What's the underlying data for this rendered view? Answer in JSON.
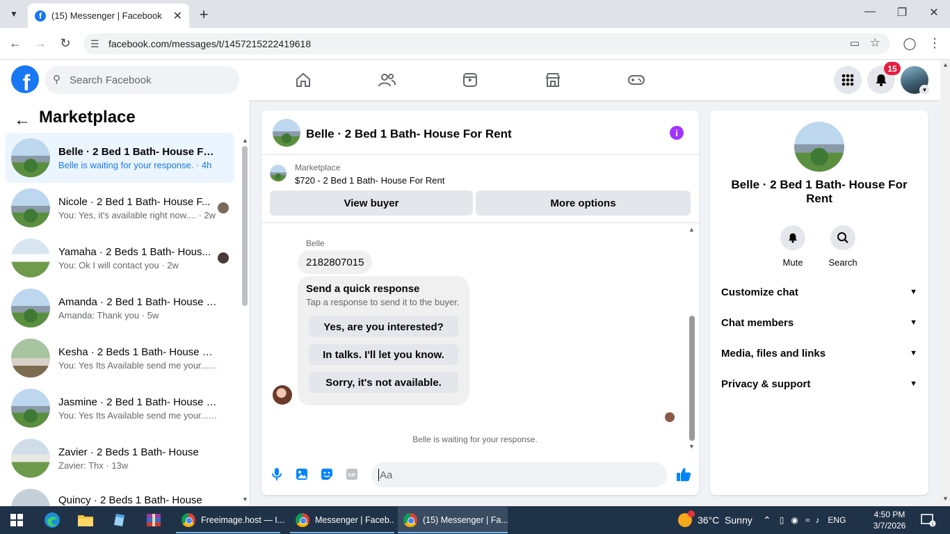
{
  "browser": {
    "tab_title": "(15) Messenger | Facebook",
    "url": "facebook.com/messages/t/1457215222419618"
  },
  "fb": {
    "search_placeholder": "Search Facebook",
    "notification_count": "15"
  },
  "left": {
    "title": "Marketplace",
    "conversations": [
      {
        "name": "Belle · 2 Bed 1 Bath- House For ...",
        "preview": "Belle is waiting for your response. · 4h"
      },
      {
        "name": "Nicole · 2 Bed 1 Bath- House F...",
        "preview": "You: Yes, it's available right now.... · 2w"
      },
      {
        "name": "Yamaha · 2 Beds 1 Bath- Hous...",
        "preview": "You: Ok I will contact you · 2w"
      },
      {
        "name": "Amanda · 2 Bed 1 Bath- House F...",
        "preview": "Amanda: Thank you · 5w"
      },
      {
        "name": "Kesha · 2 Beds 1 Bath- House Fo...",
        "preview": "You: Yes Its Available send me your... · 6w"
      },
      {
        "name": "Jasmine · 2 Bed 1 Bath- House F...",
        "preview": "You: Yes Its Available send me your... · 6w"
      },
      {
        "name": "Zavier · 2 Beds 1 Bath- House",
        "preview": "Zavier: Thx · 13w"
      },
      {
        "name": "Quincy · 2 Beds 1 Bath- House",
        "preview": ""
      }
    ]
  },
  "chat": {
    "title": "Belle · 2 Bed 1 Bath- House For Rent",
    "marketplace_label": "Marketplace",
    "listing": "$720 - 2 Bed 1 Bath- House For Rent",
    "view_buyer": "View buyer",
    "more_options": "More options",
    "sender": "Belle",
    "message": "2182807015",
    "quick_title": "Send a quick response",
    "quick_sub": "Tap a response to send it to the buyer.",
    "quick_options": [
      "Yes, are you interested?",
      "In talks. I'll let you know.",
      "Sorry, it's not available."
    ],
    "waiting": "Belle is waiting for your response.",
    "input_placeholder": "Aa"
  },
  "right": {
    "name": "Belle · 2 Bed 1 Bath- House For Rent",
    "mute": "Mute",
    "search": "Search",
    "rows": [
      "Customize chat",
      "Chat members",
      "Media, files and links",
      "Privacy & support"
    ]
  },
  "taskbar": {
    "apps": [
      "Freeimage.host — I...",
      "Messenger | Faceb...",
      "(15) Messenger | Fa..."
    ],
    "weather": "36°C  Sunny",
    "lang": "ENG",
    "time": "4:50 PM",
    "date": "3/7/2026"
  },
  "colors": {
    "fb_blue": "#1877f2",
    "messenger_blue": "#0084ff",
    "info_purple": "#a033ff",
    "badge_red": "#e41e3f"
  }
}
